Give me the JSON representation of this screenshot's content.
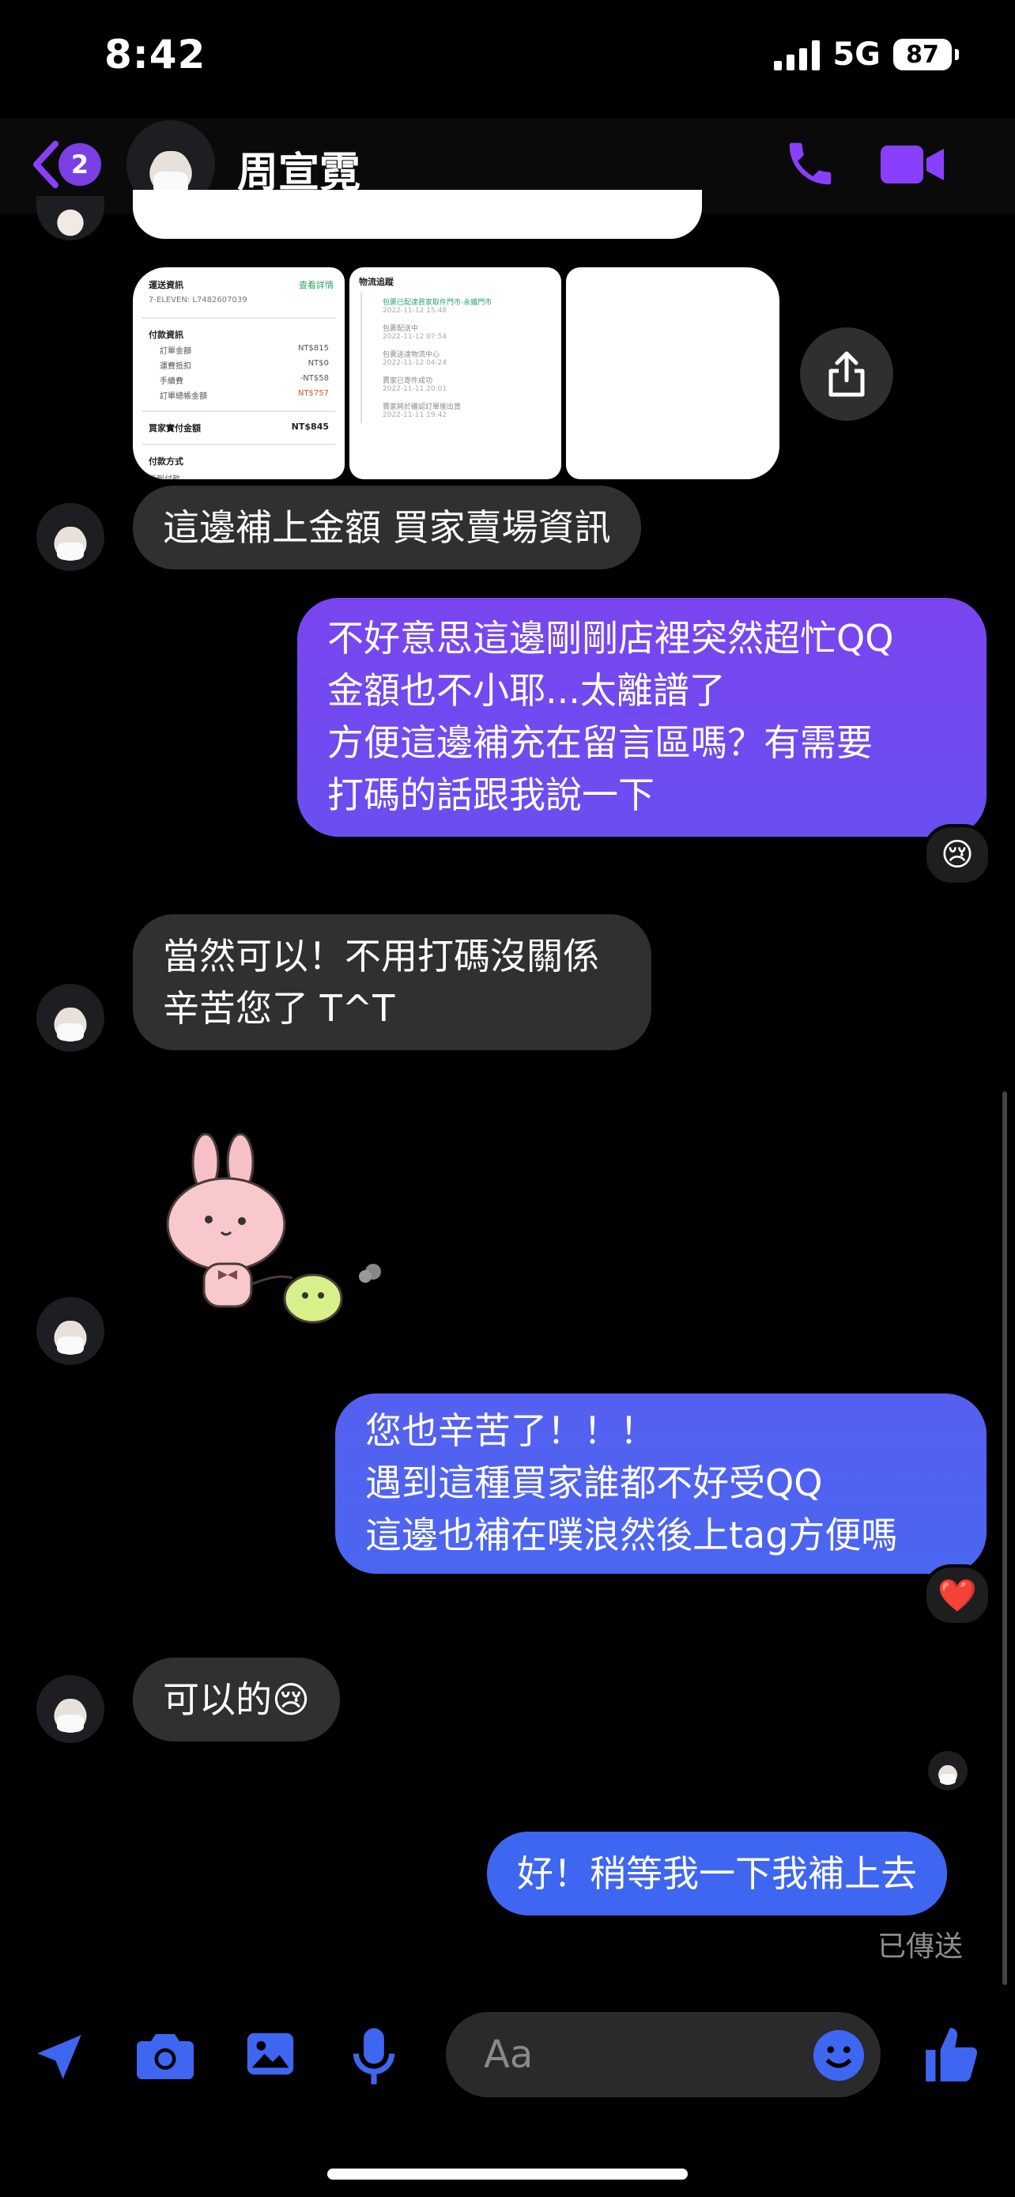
{
  "status_bar": {
    "time": "8:42",
    "network": "5G",
    "battery": "87"
  },
  "header": {
    "back_badge": "2",
    "contact_name": "周宣霓",
    "call_icon": "phone-icon",
    "video_icon": "video-camera-icon"
  },
  "shared_images": {
    "img1": {
      "title": "運送資訊",
      "link": "查看詳情",
      "tracking": "7-ELEVEN: L7482607039",
      "pay_title": "付款資訊",
      "rows": [
        [
          "訂單金額",
          "NT$815"
        ],
        [
          "運費抵扣",
          "NT$0"
        ],
        [
          "手續費",
          "-NT$58"
        ],
        [
          "訂單總帳金額",
          "NT$757"
        ]
      ],
      "buyer_label": "買家實付金額",
      "buyer_value": "NT$845",
      "method_label": "付款方式",
      "method_value": "貨到付款"
    },
    "img2": {
      "title": "物流追蹤",
      "events": [
        [
          "包裹已配達買家取件門市-永鐵門市",
          "2022-11-12 15:48"
        ],
        [
          "包裹配送中",
          "2022-11-12 07:54"
        ],
        [
          "包裹送達物流中心",
          "2022-11-12 04:24"
        ],
        [
          "賣家已寄件成功",
          "2022-11-11 20:01"
        ],
        [
          "賣家將於確認訂單後出貨",
          "2022-11-11 19:42"
        ]
      ]
    },
    "share_icon": "share-icon"
  },
  "messages": [
    {
      "id": "m1",
      "direction": "in",
      "text": "這邊補上金額 買家賣場資訊"
    },
    {
      "id": "m2",
      "direction": "out",
      "text": "不好意思這邊剛剛店裡突然超忙QQ\n金額也不小耶...太離譜了\n方便這邊補充在留言區嗎？有需要\n打碼的話跟我說一下",
      "reaction": "😢"
    },
    {
      "id": "m3",
      "direction": "in",
      "text": "當然可以！不用打碼沒關係\n辛苦您了 T^T"
    },
    {
      "id": "m4",
      "direction": "in",
      "type": "sticker",
      "sticker": "pink-bunny-sticker"
    },
    {
      "id": "m5",
      "direction": "out",
      "text": "您也辛苦了！！！\n遇到這種買家誰都不好受QQ\n這邊也補在噗浪然後上tag方便嗎",
      "reaction": "❤️"
    },
    {
      "id": "m6",
      "direction": "in",
      "text": "可以的😢"
    },
    {
      "id": "m7",
      "direction": "out",
      "text": "好！稍等我一下我補上去",
      "status": "已傳送"
    }
  ],
  "composer": {
    "placeholder": "Aa",
    "icons": [
      "location-arrow-icon",
      "camera-icon",
      "gallery-icon",
      "microphone-icon",
      "emoji-icon",
      "thumbs-up-icon"
    ]
  },
  "colors": {
    "accent": "#8a3ffc",
    "bubble_out_top": "#7b46f0",
    "bubble_out_bottom": "#3f66f0",
    "bubble_in": "#303030"
  }
}
